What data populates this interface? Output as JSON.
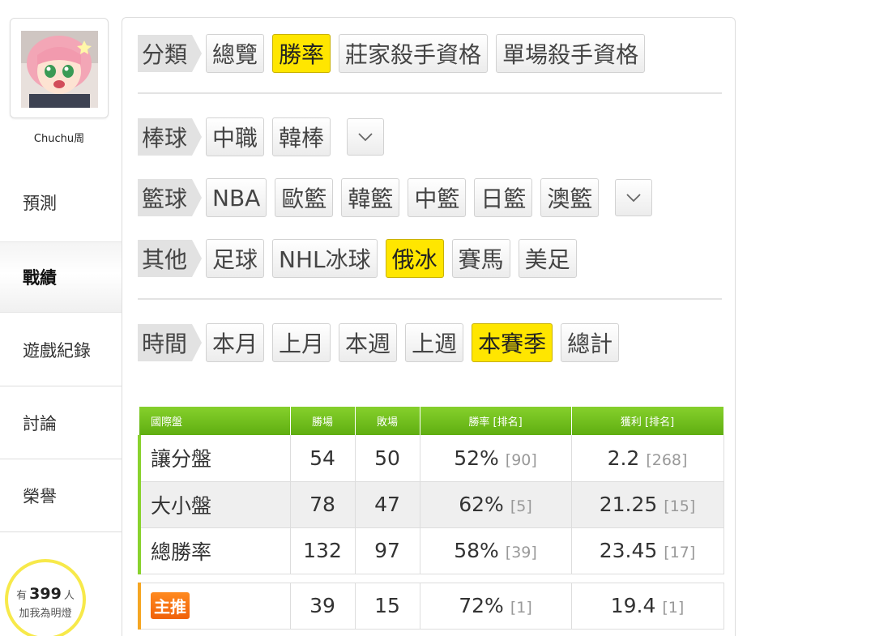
{
  "sidebar": {
    "username": "Chuchu周",
    "nav": [
      {
        "label": "預測"
      },
      {
        "label": "戰績",
        "active": true
      },
      {
        "label": "遊戲紀錄"
      },
      {
        "label": "討論"
      },
      {
        "label": "榮譽"
      }
    ],
    "fans": {
      "prefix": "有",
      "count": "399",
      "suffix": "人",
      "cta": "加我為明燈"
    }
  },
  "filters": {
    "category": {
      "label": "分類",
      "options": [
        "總覽",
        "勝率",
        "莊家殺手資格",
        "單場殺手資格"
      ],
      "selected": "勝率"
    },
    "baseball": {
      "label": "棒球",
      "options": [
        "中職",
        "韓棒"
      ]
    },
    "basketball": {
      "label": "籃球",
      "options": [
        "NBA",
        "歐籃",
        "韓籃",
        "中籃",
        "日籃",
        "澳籃"
      ]
    },
    "other": {
      "label": "其他",
      "options": [
        "足球",
        "NHL冰球",
        "俄冰",
        "賽馬",
        "美足"
      ],
      "selected": "俄冰"
    },
    "time": {
      "label": "時間",
      "options": [
        "本月",
        "上月",
        "本週",
        "上週",
        "本賽季",
        "總計"
      ],
      "selected": "本賽季"
    }
  },
  "table": {
    "headers": [
      "國際盤",
      "勝場",
      "敗場",
      "勝率 [排名]",
      "獲利 [排名]"
    ],
    "rows": [
      {
        "label": "讓分盤",
        "wins": "54",
        "losses": "50",
        "rate": "52%",
        "rate_rank": "[90]",
        "profit": "2.2",
        "profit_rank": "[268]"
      },
      {
        "label": "大小盤",
        "wins": "78",
        "losses": "47",
        "rate": "62%",
        "rate_rank": "[5]",
        "profit": "21.25",
        "profit_rank": "[15]"
      },
      {
        "label": "總勝率",
        "wins": "132",
        "losses": "97",
        "rate": "58%",
        "rate_rank": "[39]",
        "profit": "23.45",
        "profit_rank": "[17]"
      }
    ],
    "featured": {
      "label": "主推",
      "wins": "39",
      "losses": "15",
      "rate": "72%",
      "rate_rank": "[1]",
      "profit": "19.4",
      "profit_rank": "[1]"
    }
  },
  "colors": {
    "accent_yellow": "#ffe600",
    "header_green": "#6cbf1a",
    "badge_orange": "#f07410",
    "fan_ring": "#f7e94a"
  },
  "icons": {
    "dropdown": "chevron-down-icon"
  }
}
